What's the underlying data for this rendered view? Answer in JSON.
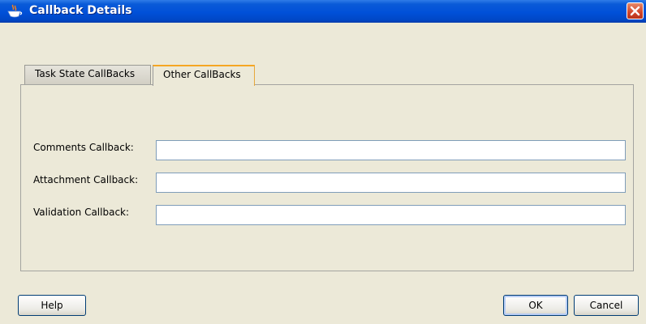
{
  "window": {
    "title": "Callback Details",
    "title_icon": "java-cup-icon",
    "close_icon": "close-icon",
    "titlebar_color": "#0050d8"
  },
  "tabs": [
    {
      "label": "Task State CallBacks",
      "active": false
    },
    {
      "label": "Other CallBacks",
      "active": true
    }
  ],
  "fields": [
    {
      "label": "Comments Callback:",
      "value": ""
    },
    {
      "label": "Attachment Callback:",
      "value": ""
    },
    {
      "label": "Validation Callback:",
      "value": ""
    }
  ],
  "buttons": {
    "help": "Help",
    "ok": "OK",
    "cancel": "Cancel"
  },
  "colors": {
    "active_tab_accent": "#f5a623",
    "dialog_background": "#ece9d8",
    "close_button": "#d1442a"
  }
}
